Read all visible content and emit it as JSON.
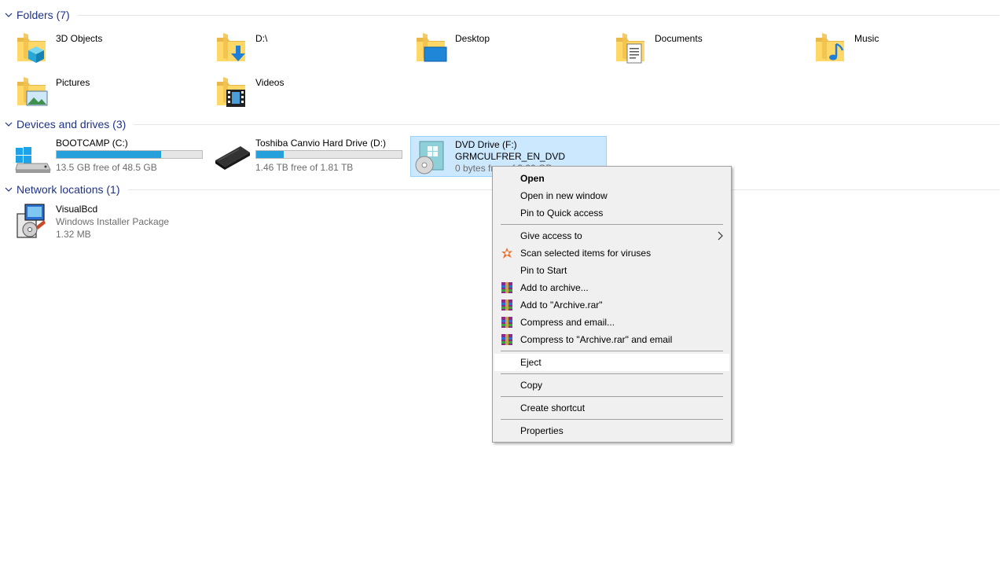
{
  "groups": {
    "folders": {
      "title": "Folders (7)"
    },
    "devices": {
      "title": "Devices and drives (3)"
    },
    "network": {
      "title": "Network locations (1)"
    }
  },
  "folders": [
    {
      "name": "3D Objects",
      "icon": "3d-objects-folder-icon"
    },
    {
      "name": "D:\\",
      "icon": "downloads-folder-icon"
    },
    {
      "name": "Desktop",
      "icon": "desktop-folder-icon"
    },
    {
      "name": "Documents",
      "icon": "documents-folder-icon"
    },
    {
      "name": "Music",
      "icon": "music-folder-icon"
    },
    {
      "name": "Pictures",
      "icon": "pictures-folder-icon"
    },
    {
      "name": "Videos",
      "icon": "videos-folder-icon"
    }
  ],
  "drives": [
    {
      "name": "BOOTCAMP (C:)",
      "free": "13.5 GB free of 48.5 GB",
      "used_fraction": 0.72,
      "icon": "windows-drive-icon"
    },
    {
      "name": "Toshiba Canvio Hard Drive (D:)",
      "free": "1.46 TB free of 1.81 TB",
      "used_fraction": 0.19,
      "icon": "external-hdd-icon"
    },
    {
      "name": "DVD Drive (F:)",
      "label": "GRMCULFRER_EN_DVD",
      "free": "0 bytes free of 3.20 GB",
      "icon": "dvd-drive-icon"
    }
  ],
  "network": [
    {
      "name": "VisualBcd",
      "type": "Windows Installer Package",
      "size": "1.32 MB",
      "icon": "installer-package-icon"
    }
  ],
  "context_menu": {
    "items": [
      {
        "label": "Open",
        "bold": true
      },
      {
        "label": "Open in new window"
      },
      {
        "label": "Pin to Quick access"
      },
      {
        "label": "Give access to",
        "submenu": true
      },
      {
        "label": "Scan selected items for viruses",
        "icon": "avast-icon"
      },
      {
        "label": "Pin to Start"
      },
      {
        "label": "Add to archive...",
        "icon": "winrar-icon"
      },
      {
        "label": "Add to \"Archive.rar\"",
        "icon": "winrar-icon"
      },
      {
        "label": "Compress and email...",
        "icon": "winrar-icon"
      },
      {
        "label": "Compress to \"Archive.rar\" and email",
        "icon": "winrar-icon"
      },
      {
        "label": "Eject",
        "hover": true
      },
      {
        "label": "Copy"
      },
      {
        "label": "Create shortcut"
      },
      {
        "label": "Properties"
      }
    ]
  },
  "colors": {
    "group_header": "#1e3287",
    "selection_bg": "#cce8ff",
    "selection_border": "#99d1ff",
    "drive_bar_fill": "#26a0da"
  }
}
